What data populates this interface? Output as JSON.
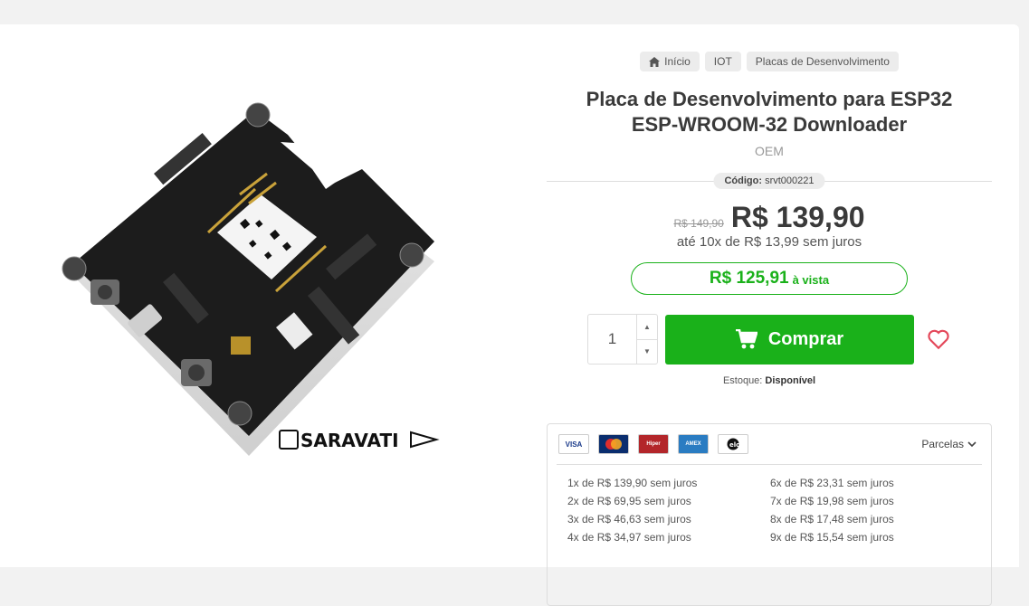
{
  "breadcrumb": [
    {
      "label": "Início",
      "icon": "home-icon"
    },
    {
      "label": "IOT"
    },
    {
      "label": "Placas de Desenvolvimento"
    }
  ],
  "product": {
    "title": "Placa de Desenvolvimento para ESP32 ESP-WROOM-32 Downloader",
    "brand": "OEM",
    "code_label": "Código:",
    "code_value": "srvt000221",
    "old_price": "R$ 149,90",
    "price": "R$ 139,90",
    "installments": "até 10x de R$ 13,99 sem juros",
    "cash_price": "R$ 125,91",
    "cash_label": "à vista",
    "stock_label": "Estoque:",
    "stock_value": "Disponível",
    "image_logo": "SARAVATI"
  },
  "purchase": {
    "quantity": "1",
    "buy_label": "Comprar"
  },
  "payment": {
    "cards": [
      "VISA",
      "Mastercard",
      "Hipercard",
      "American Express",
      "Elo"
    ],
    "parcelas_label": "Parcelas",
    "installments_left": [
      "1x de R$ 139,90 sem juros",
      "2x de R$ 69,95 sem juros",
      "3x de R$ 46,63 sem juros",
      "4x de R$ 34,97 sem juros"
    ],
    "installments_right": [
      "6x de R$ 23,31 sem juros",
      "7x de R$ 19,98 sem juros",
      "8x de R$ 17,48 sem juros",
      "9x de R$ 15,54 sem juros"
    ]
  },
  "colors": {
    "accent_green": "#1ab11a",
    "heart_red": "#e4485a"
  }
}
